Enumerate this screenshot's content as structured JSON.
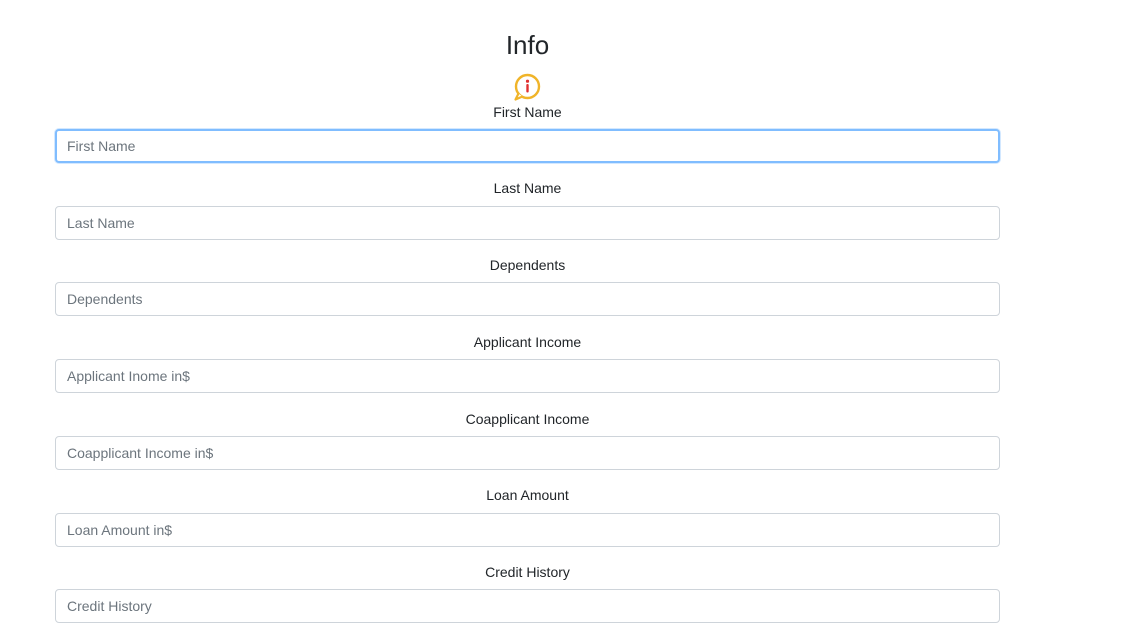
{
  "page": {
    "title": "Info",
    "icon": "info-bubble-icon",
    "colors": {
      "icon_ring": "#f0b429",
      "icon_glyph": "#e03131",
      "focus_border": "#80bdff"
    }
  },
  "fields": [
    {
      "label": "First Name",
      "placeholder": "First Name"
    },
    {
      "label": "Last Name",
      "placeholder": "Last Name"
    },
    {
      "label": "Dependents",
      "placeholder": "Dependents"
    },
    {
      "label": "Applicant Income",
      "placeholder": "Applicant Inome in$"
    },
    {
      "label": "Coapplicant Income",
      "placeholder": "Coapplicant Income in$"
    },
    {
      "label": "Loan Amount",
      "placeholder": "Loan Amount in$"
    },
    {
      "label": "Credit History",
      "placeholder": "Credit History"
    }
  ]
}
